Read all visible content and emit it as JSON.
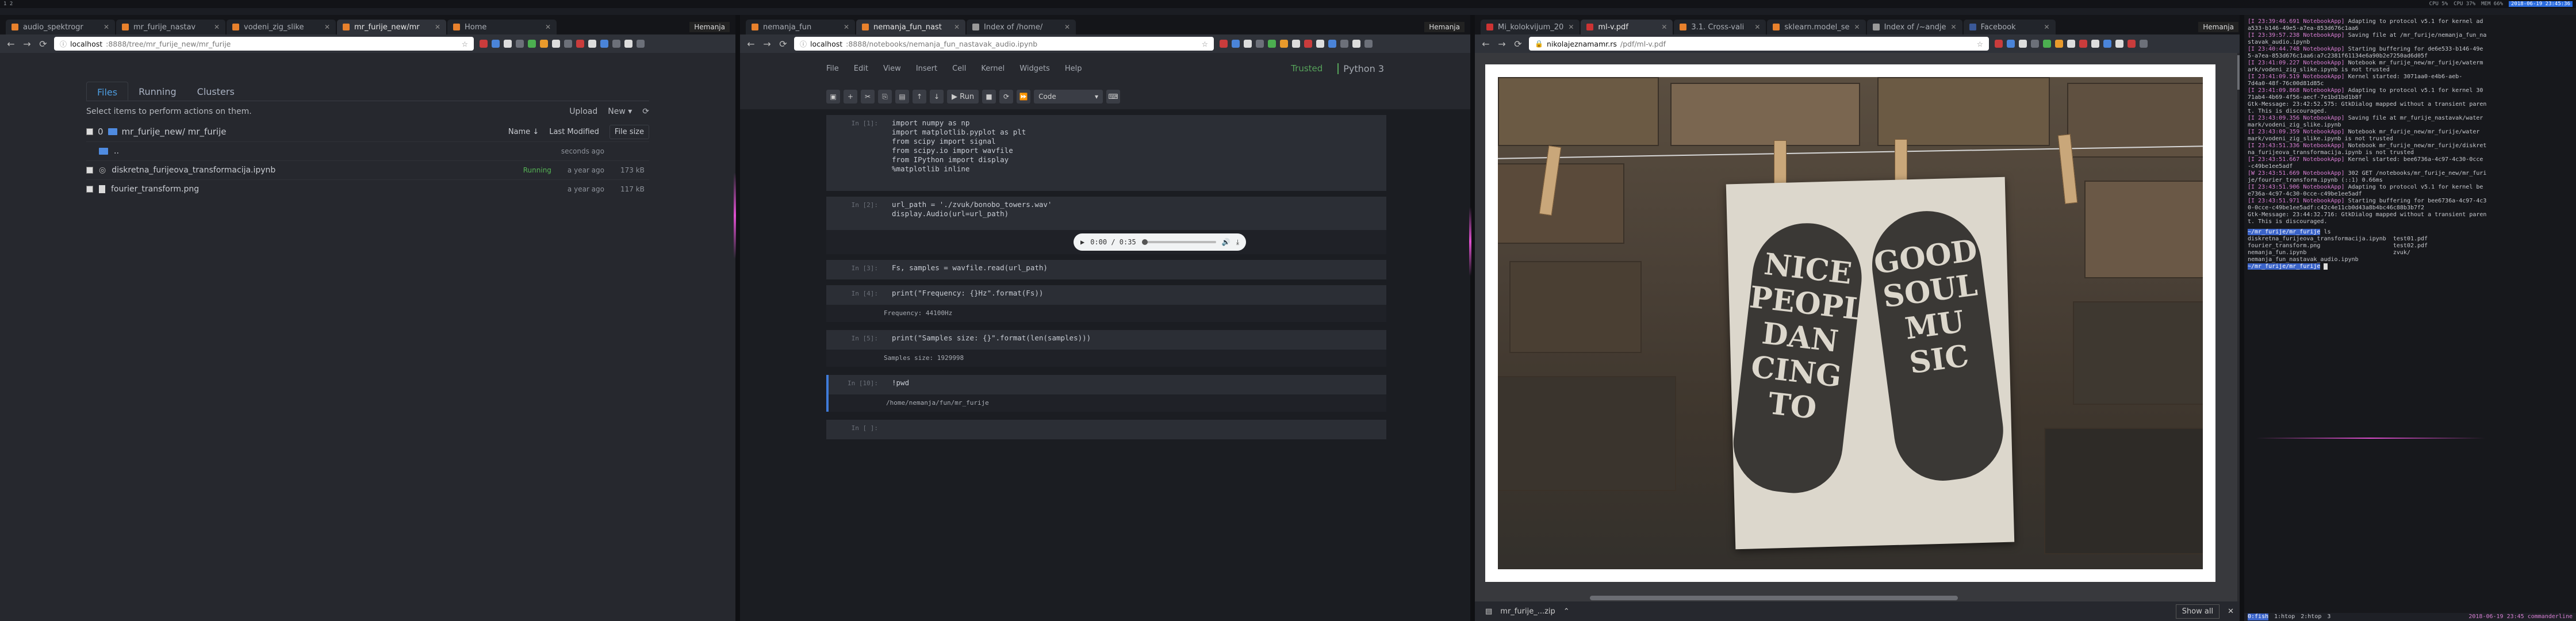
{
  "topbar": {
    "left": "1 2",
    "right_items": [
      "CPU 5%",
      "CPU 37%",
      "MEM 66%",
      "2018-06-19 23:45:36"
    ],
    "workspace": "4"
  },
  "win1": {
    "tabs": [
      {
        "label": "audio_spektrogr"
      },
      {
        "label": "mr_furije_nastav"
      },
      {
        "label": "vodeni_zig_slike"
      },
      {
        "label": "mr_furije_new/mr"
      },
      {
        "label": "Home"
      }
    ],
    "right_tag": "Hemanja",
    "url_host": "localhost",
    "url_path": ":8888/tree/mr_furije_new/mr_furije",
    "files_tabs": [
      "Files",
      "Running",
      "Clusters"
    ],
    "hint": "Select items to perform actions on them.",
    "upload": "Upload",
    "new": "New ▾",
    "refresh": "⟳",
    "count": "0",
    "breadcrumb": "mr_furije_new/ mr_furije",
    "col_name": "Name ↓",
    "col_modified": "Last Modified",
    "col_size": "File size",
    "rows": [
      {
        "name": "..",
        "modified": "seconds ago",
        "size": "",
        "running": ""
      },
      {
        "name": "diskretna_furijeova_transformacija.ipynb",
        "modified": "a year ago",
        "size": "173 kB",
        "running": "Running"
      },
      {
        "name": "fourier_transform.png",
        "modified": "a year ago",
        "size": "117 kB",
        "running": ""
      }
    ]
  },
  "win2": {
    "tabs": [
      {
        "label": "nemanja_fun"
      },
      {
        "label": "nemanja_fun_nast"
      },
      {
        "label": "Index of /home/"
      }
    ],
    "right_tag": "Hemanja",
    "url_host": "localhost",
    "url_path": ":8888/notebooks/nemanja_fun_nastavak_audio.ipynb",
    "menu": [
      "File",
      "Edit",
      "View",
      "Insert",
      "Cell",
      "Kernel",
      "Widgets",
      "Help"
    ],
    "trusted": "Trusted",
    "kernel": "Python 3",
    "run_label": "▶ Run",
    "celltype": "Code",
    "cells": [
      {
        "prompt": "In [1]:",
        "code": "import numpy as np\nimport matplotlib.pyplot as plt\nfrom scipy import signal\nfrom scipy.io import wavfile\nfrom IPython import display\n%matplotlib inline"
      },
      {
        "prompt": "In [2]:",
        "code": "url_path = './zvuk/bonobo_towers.wav'\ndisplay.Audio(url=url_path)"
      },
      {
        "prompt": "In [3]:",
        "code": "Fs, samples = wavfile.read(url_path)"
      },
      {
        "prompt": "In [4]:",
        "code": "print(\"Frequency: {}Hz\".format(Fs))"
      },
      {
        "prompt": "In [5]:",
        "code": "print(\"Samples size: {}\".format(len(samples)))"
      },
      {
        "prompt": "In [10]:",
        "code": "!pwd"
      },
      {
        "prompt": "In [ ]:",
        "code": ""
      }
    ],
    "outputs": [
      "Frequency: 44100Hz",
      "Samples size: 1929998",
      "/home/nemanja/fun/mr_furije"
    ],
    "audio_time": "0:00 / 0:35"
  },
  "win3": {
    "tabs": [
      {
        "label": "Mi_kolokvijum_20"
      },
      {
        "label": "ml-v.pdf"
      },
      {
        "label": "3.1.  Cross-vali"
      },
      {
        "label": "sklearn.model_se"
      },
      {
        "label": "Index of /~andje"
      },
      {
        "label": "Facebook"
      }
    ],
    "right_tag": "Hemanja",
    "url_host": "nikolajeznamamr.rs",
    "url_path": "/pdf/ml-v.pdf",
    "poster_left": "NICE PEOPLE DAN CING TO",
    "poster_right": "GOOD SOUL MU SIC",
    "download": "mr_furije_...zip",
    "showall": "Show all"
  },
  "term": {
    "lines": [
      {
        "ts": "[I 23:39:46.691 NotebookApp]",
        "msg": " Adapting to protocol v5.1 for kernel ad"
      },
      {
        "ts": "",
        "msg": "a533-b146-49e5-a7ea-853d676c1aa6"
      },
      {
        "ts": "[I 23:39:57.238 NotebookApp]",
        "msg": " Saving file at /mr_furije/nemanja_fun_na"
      },
      {
        "ts": "",
        "msg": "stavak_audio.ipynb"
      },
      {
        "ts": "[I 23:40:44.748 NotebookApp]",
        "msg": " Starting buffering for de6e533-b146-49e"
      },
      {
        "ts": "",
        "msg": "5-a7ea-853d676c1aa6:a7c2381f61134e6a90b2e7250ad6d05f"
      },
      {
        "ts": "[I 23:41:09.227 NotebookApp]",
        "msg": " Notebook mr_furije_new/mr_furije/waterm"
      },
      {
        "ts": "",
        "msg": "ark/vodeni_zig_slike.ipynb is not trusted"
      },
      {
        "ts": "[I 23:41:09.519 NotebookApp]",
        "msg": " Kernel started: 3071aa0-e4b6-aeb-"
      },
      {
        "ts": "",
        "msg": "7d4a0-48f-76c00d81d85c"
      },
      {
        "ts": "[I 23:41:09.868 NotebookApp]",
        "msg": " Adapting to protocol v5.1 for kernel 30"
      },
      {
        "ts": "",
        "msg": "71ab4-4b69-4f56-aecf-7e1bd1bd1b8f"
      },
      {
        "ts": "",
        "msg": "Gtk-Message: 23:42:52.575: GtkDialog mapped without a transient paren"
      },
      {
        "ts": "",
        "msg": "t. This is discouraged."
      },
      {
        "ts": "[I 23:43:09.356 NotebookApp]",
        "msg": " Saving file at mr_furije_nastavak/water"
      },
      {
        "ts": "",
        "msg": "mark/vodeni_zig_slike.ipynb"
      },
      {
        "ts": "[I 23:43:09.359 NotebookApp]",
        "msg": " Notebook mr_furije_new/mr_furije/water"
      },
      {
        "ts": "",
        "msg": "mark/vodeni_zig_slike.ipynb is not trusted"
      },
      {
        "ts": "[I 23:43:51.336 NotebookApp]",
        "msg": " Notebook mr_furije_new/mr_furije/diskret"
      },
      {
        "ts": "",
        "msg": "na_furijeova_transformacija.ipynb is not trusted"
      },
      {
        "ts": "[I 23:43:51.667 NotebookApp]",
        "msg": " Kernel started: bee6736a-4c97-4c30-0cce"
      },
      {
        "ts": "",
        "msg": "-c49be1ee5adf"
      },
      {
        "ts": "[W 23:43:51.669 NotebookApp]",
        "msg": " 302 GET /notebooks/mr_furije_new/mr_furi"
      },
      {
        "ts": "",
        "msg": "je/fourier_transform.ipynb (::1) 0.66ms"
      },
      {
        "ts": "[I 23:43:51.906 NotebookApp]",
        "msg": " Adapting to protocol v5.1 for kernel be"
      },
      {
        "ts": "",
        "msg": "e736a-4c97-4c30-0cce-c49be1ee5adf"
      },
      {
        "ts": "[I 23:43:51.971 NotebookApp]",
        "msg": " Starting buffering for bee6736a-4c97-4c3"
      },
      {
        "ts": "",
        "msg": "0-0cce-c49be1ee5adf:c42c4e11cb0d43a8b4bc46c88b3b7f2"
      },
      {
        "ts": "",
        "msg": "Gtk-Message: 23:44:32.716: GtkDialog mapped without a transient paren"
      },
      {
        "ts": "",
        "msg": "t. This is discouraged."
      }
    ],
    "prompt_path": "~/mr_furije/mr_furije",
    "ls": [
      "diskretna_furijeova_transformacija.ipynb  test01.pdf",
      "fourier_transform.png                     test02.pdf",
      "nemanja_fun.ipynb                         zvuk/",
      "nemanja_fun_nastavak_audio.ipynb"
    ],
    "prompt2": "~/mr_furije/mr_furije",
    "status_items": [
      "0:fish",
      "1:htop",
      "2:htop",
      "3"
    ],
    "status_right": "2018-06-19  23:45  commanderline"
  }
}
